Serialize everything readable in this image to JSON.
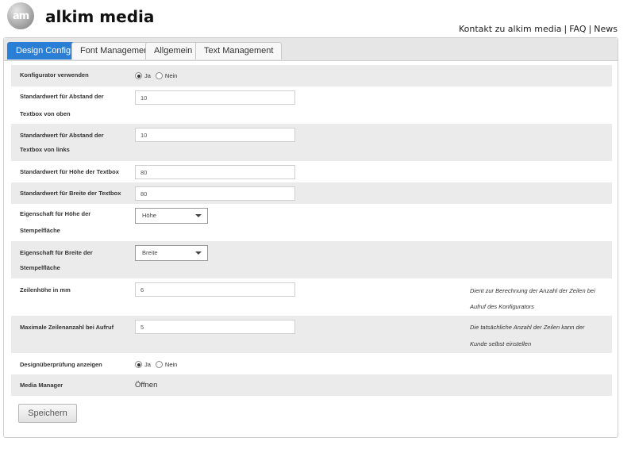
{
  "header": {
    "logo_text": "am",
    "brand": "alkim media",
    "links": [
      "Kontakt zu alkim media",
      "FAQ",
      "News"
    ],
    "separator": "|"
  },
  "tabs": [
    {
      "label": "Design Config",
      "active": true
    },
    {
      "label": "Font Management",
      "active": false
    },
    {
      "label": "Allgemein",
      "active": false
    },
    {
      "label": "Text Management",
      "active": false
    }
  ],
  "form": {
    "konfigurator": {
      "label": "Konfigurator verwenden",
      "options": [
        "Ja",
        "Nein"
      ],
      "selected": "Ja"
    },
    "abstand_oben": {
      "label_line1": "Standardwert für Abstand der",
      "label_line2": "Textbox von oben",
      "value": "10"
    },
    "abstand_links": {
      "label_line1": "Standardwert für Abstand der",
      "label_line2": "Textbox von links",
      "value": "10"
    },
    "hoehe_textbox": {
      "label": "Standardwert für Höhe der Textbox",
      "value": "80"
    },
    "breite_textbox": {
      "label": "Standardwert für Breite der Textbox",
      "value": "80"
    },
    "hoehe_stempel": {
      "label_line1": "Eigenschaft für Höhe der",
      "label_line2": "Stempelfläche",
      "selected": "Höhe"
    },
    "breite_stempel": {
      "label_line1": "Eigenschaft für Breite der",
      "label_line2": "Stempelfläche",
      "selected": "Breite"
    },
    "zeilenhoehe": {
      "label": "Zeilenhöhe in mm",
      "value": "6",
      "hint_line1": "Dient zur Berechnung der Anzahl der Zeilen bei",
      "hint_line2": "Aufruf des Konfigurators"
    },
    "max_zeilen": {
      "label": "Maximale Zeilenanzahl bei Aufruf",
      "value": "5",
      "hint_line1": "Die tatsächliche Anzahl der Zeilen kann der",
      "hint_line2": "Kunde selbst einstellen"
    },
    "designpruefung": {
      "label": "Designüberprüfung anzeigen",
      "options": [
        "Ja",
        "Nein"
      ],
      "selected": "Ja"
    },
    "media_manager": {
      "label": "Media Manager",
      "action": "Öffnen"
    }
  },
  "save_label": "Speichern"
}
